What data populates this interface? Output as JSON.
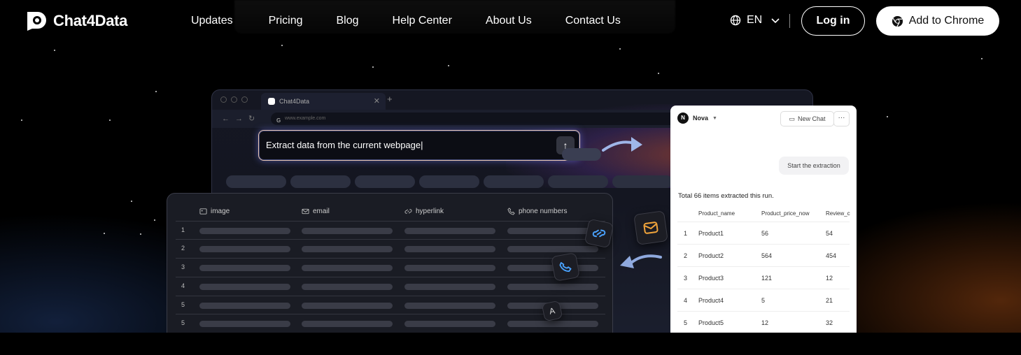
{
  "brand": {
    "name": "Chat4Data"
  },
  "nav": {
    "items": [
      "Updates",
      "Pricing",
      "Blog",
      "Help Center",
      "About Us",
      "Contact Us"
    ],
    "language": "EN",
    "login_label": "Log in",
    "add_chrome_label": "Add to Chrome"
  },
  "browser": {
    "tab_title": "Chat4Data",
    "url": "www.example.com",
    "prompt_text": "Extract data from the current webpage|"
  },
  "data_table": {
    "columns": [
      "image",
      "email",
      "hyperlink",
      "phone numbers"
    ],
    "row_numbers": [
      "1",
      "2",
      "3",
      "4",
      "5",
      "5"
    ]
  },
  "chat": {
    "agent_name": "Nova",
    "new_chat_label": "New Chat",
    "more_label": "···",
    "user_message": "Start the extraction",
    "summary": "Total 66 items extracted this run.",
    "columns": [
      "Product_name",
      "Product_price_now",
      "Review_c"
    ],
    "rows": [
      {
        "n": "1",
        "name": "Product1",
        "price": "56",
        "review": "54"
      },
      {
        "n": "2",
        "name": "Product2",
        "price": "564",
        "review": "454"
      },
      {
        "n": "3",
        "name": "Product3",
        "price": "121",
        "review": "12"
      },
      {
        "n": "4",
        "name": "Product4",
        "price": "5",
        "review": "21"
      },
      {
        "n": "5",
        "name": "Product5",
        "price": "12",
        "review": "32"
      }
    ]
  },
  "floating_icons": [
    "link-icon",
    "mail-icon",
    "phone-icon",
    "image-icon",
    "text-icon"
  ],
  "floating_text_icon_letter": "A",
  "colors": {
    "accent_orange": "#f2a53b",
    "accent_blue": "#4aa3ff",
    "accent_green": "#3bd66b"
  }
}
